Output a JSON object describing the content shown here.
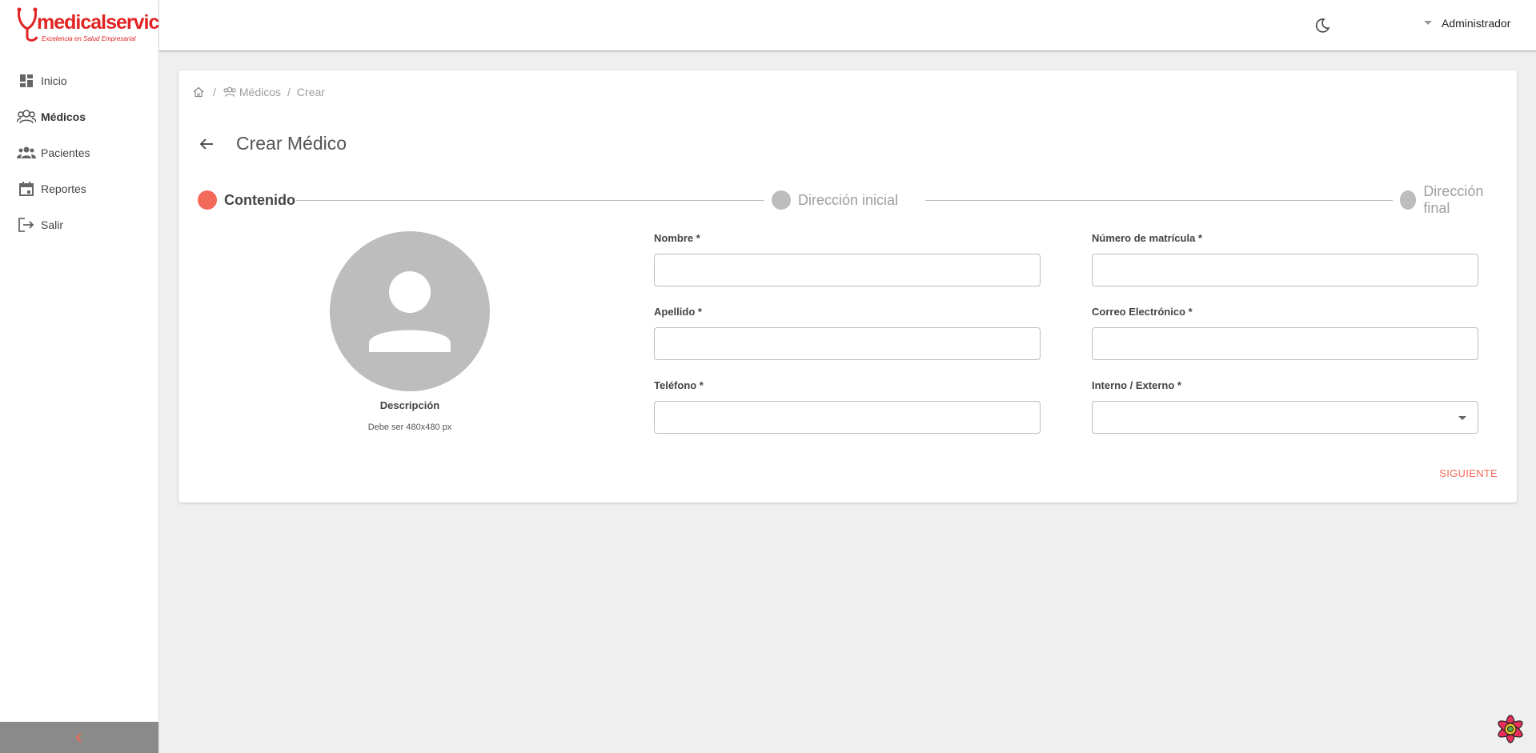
{
  "app": {
    "logo_text": "medicalservice",
    "logo_tagline": "Excelencia en Salud Empresarial",
    "brand_color": "#e02424",
    "accent_color": "#f46a5a"
  },
  "sidebar": {
    "items": [
      {
        "label": "Inicio",
        "icon": "dashboard-icon"
      },
      {
        "label": "Médicos",
        "icon": "doctors-icon"
      },
      {
        "label": "Pacientes",
        "icon": "patients-icon"
      },
      {
        "label": "Reportes",
        "icon": "calendar-icon"
      },
      {
        "label": "Salir",
        "icon": "logout-icon"
      }
    ],
    "active_item": "Médicos",
    "collapse_icon": "chevron-left-icon"
  },
  "header": {
    "theme_icon": "moon-icon",
    "user_name": "Administrador"
  },
  "breadcrumb": {
    "items": [
      "Médicos",
      "Crear"
    ],
    "separator": "/"
  },
  "page": {
    "title": "Crear Médico"
  },
  "stepper": {
    "steps": [
      "Contenido",
      "Dirección inicial",
      "Dirección final"
    ],
    "active_step": 0
  },
  "avatar": {
    "title": "Descripción",
    "hint": "Debe ser 480x480 px"
  },
  "form": {
    "nombre_label": "Nombre *",
    "nombre_value": "",
    "apellido_label": "Apellido *",
    "apellido_value": "",
    "telefono_label": "Teléfono *",
    "telefono_value": "",
    "matricula_label": "Número de matrícula *",
    "matricula_value": "",
    "correo_label": "Correo Electrónico *",
    "correo_value": "",
    "tipo_label": "Interno / Externo *",
    "tipo_value": ""
  },
  "actions": {
    "next_label": "SIGUIENTE"
  }
}
